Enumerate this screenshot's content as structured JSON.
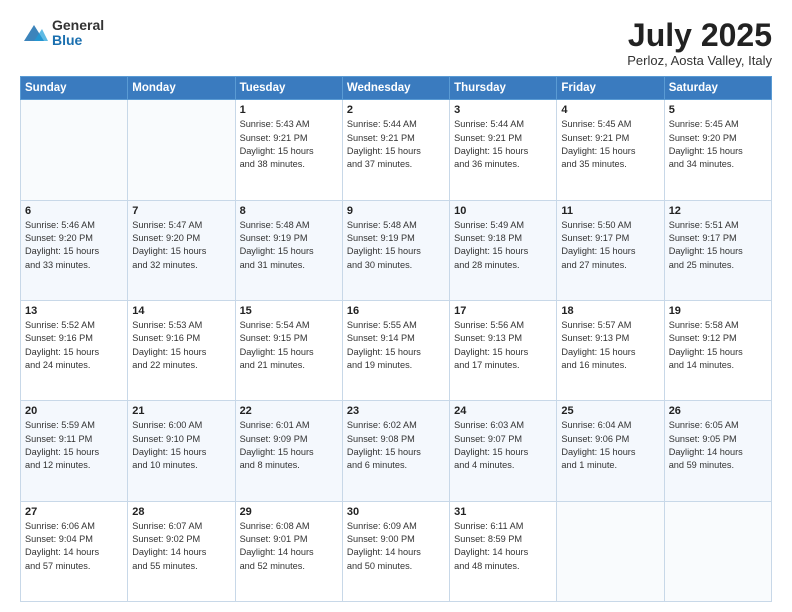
{
  "logo": {
    "general": "General",
    "blue": "Blue"
  },
  "title": "July 2025",
  "subtitle": "Perloz, Aosta Valley, Italy",
  "weekdays": [
    "Sunday",
    "Monday",
    "Tuesday",
    "Wednesday",
    "Thursday",
    "Friday",
    "Saturday"
  ],
  "weeks": [
    [
      {
        "day": "",
        "info": ""
      },
      {
        "day": "",
        "info": ""
      },
      {
        "day": "1",
        "info": "Sunrise: 5:43 AM\nSunset: 9:21 PM\nDaylight: 15 hours\nand 38 minutes."
      },
      {
        "day": "2",
        "info": "Sunrise: 5:44 AM\nSunset: 9:21 PM\nDaylight: 15 hours\nand 37 minutes."
      },
      {
        "day": "3",
        "info": "Sunrise: 5:44 AM\nSunset: 9:21 PM\nDaylight: 15 hours\nand 36 minutes."
      },
      {
        "day": "4",
        "info": "Sunrise: 5:45 AM\nSunset: 9:21 PM\nDaylight: 15 hours\nand 35 minutes."
      },
      {
        "day": "5",
        "info": "Sunrise: 5:45 AM\nSunset: 9:20 PM\nDaylight: 15 hours\nand 34 minutes."
      }
    ],
    [
      {
        "day": "6",
        "info": "Sunrise: 5:46 AM\nSunset: 9:20 PM\nDaylight: 15 hours\nand 33 minutes."
      },
      {
        "day": "7",
        "info": "Sunrise: 5:47 AM\nSunset: 9:20 PM\nDaylight: 15 hours\nand 32 minutes."
      },
      {
        "day": "8",
        "info": "Sunrise: 5:48 AM\nSunset: 9:19 PM\nDaylight: 15 hours\nand 31 minutes."
      },
      {
        "day": "9",
        "info": "Sunrise: 5:48 AM\nSunset: 9:19 PM\nDaylight: 15 hours\nand 30 minutes."
      },
      {
        "day": "10",
        "info": "Sunrise: 5:49 AM\nSunset: 9:18 PM\nDaylight: 15 hours\nand 28 minutes."
      },
      {
        "day": "11",
        "info": "Sunrise: 5:50 AM\nSunset: 9:17 PM\nDaylight: 15 hours\nand 27 minutes."
      },
      {
        "day": "12",
        "info": "Sunrise: 5:51 AM\nSunset: 9:17 PM\nDaylight: 15 hours\nand 25 minutes."
      }
    ],
    [
      {
        "day": "13",
        "info": "Sunrise: 5:52 AM\nSunset: 9:16 PM\nDaylight: 15 hours\nand 24 minutes."
      },
      {
        "day": "14",
        "info": "Sunrise: 5:53 AM\nSunset: 9:16 PM\nDaylight: 15 hours\nand 22 minutes."
      },
      {
        "day": "15",
        "info": "Sunrise: 5:54 AM\nSunset: 9:15 PM\nDaylight: 15 hours\nand 21 minutes."
      },
      {
        "day": "16",
        "info": "Sunrise: 5:55 AM\nSunset: 9:14 PM\nDaylight: 15 hours\nand 19 minutes."
      },
      {
        "day": "17",
        "info": "Sunrise: 5:56 AM\nSunset: 9:13 PM\nDaylight: 15 hours\nand 17 minutes."
      },
      {
        "day": "18",
        "info": "Sunrise: 5:57 AM\nSunset: 9:13 PM\nDaylight: 15 hours\nand 16 minutes."
      },
      {
        "day": "19",
        "info": "Sunrise: 5:58 AM\nSunset: 9:12 PM\nDaylight: 15 hours\nand 14 minutes."
      }
    ],
    [
      {
        "day": "20",
        "info": "Sunrise: 5:59 AM\nSunset: 9:11 PM\nDaylight: 15 hours\nand 12 minutes."
      },
      {
        "day": "21",
        "info": "Sunrise: 6:00 AM\nSunset: 9:10 PM\nDaylight: 15 hours\nand 10 minutes."
      },
      {
        "day": "22",
        "info": "Sunrise: 6:01 AM\nSunset: 9:09 PM\nDaylight: 15 hours\nand 8 minutes."
      },
      {
        "day": "23",
        "info": "Sunrise: 6:02 AM\nSunset: 9:08 PM\nDaylight: 15 hours\nand 6 minutes."
      },
      {
        "day": "24",
        "info": "Sunrise: 6:03 AM\nSunset: 9:07 PM\nDaylight: 15 hours\nand 4 minutes."
      },
      {
        "day": "25",
        "info": "Sunrise: 6:04 AM\nSunset: 9:06 PM\nDaylight: 15 hours\nand 1 minute."
      },
      {
        "day": "26",
        "info": "Sunrise: 6:05 AM\nSunset: 9:05 PM\nDaylight: 14 hours\nand 59 minutes."
      }
    ],
    [
      {
        "day": "27",
        "info": "Sunrise: 6:06 AM\nSunset: 9:04 PM\nDaylight: 14 hours\nand 57 minutes."
      },
      {
        "day": "28",
        "info": "Sunrise: 6:07 AM\nSunset: 9:02 PM\nDaylight: 14 hours\nand 55 minutes."
      },
      {
        "day": "29",
        "info": "Sunrise: 6:08 AM\nSunset: 9:01 PM\nDaylight: 14 hours\nand 52 minutes."
      },
      {
        "day": "30",
        "info": "Sunrise: 6:09 AM\nSunset: 9:00 PM\nDaylight: 14 hours\nand 50 minutes."
      },
      {
        "day": "31",
        "info": "Sunrise: 6:11 AM\nSunset: 8:59 PM\nDaylight: 14 hours\nand 48 minutes."
      },
      {
        "day": "",
        "info": ""
      },
      {
        "day": "",
        "info": ""
      }
    ]
  ]
}
